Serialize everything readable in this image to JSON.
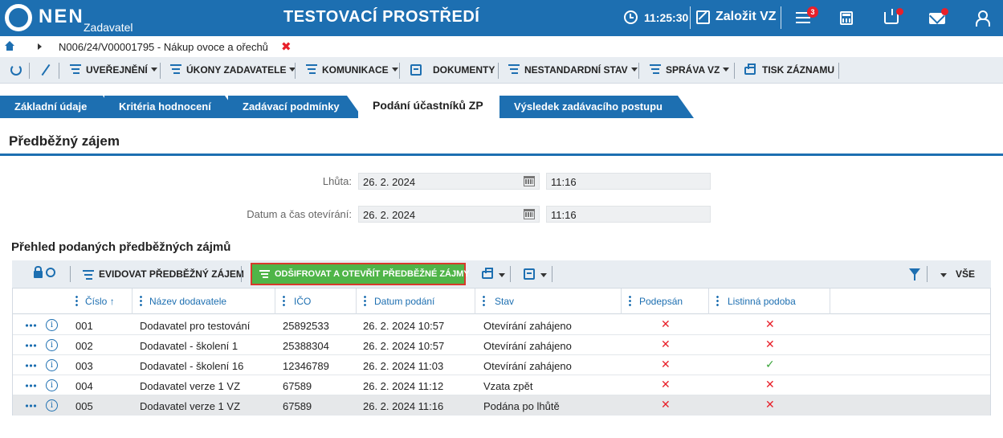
{
  "header": {
    "logo_text": "NEN",
    "logo_sub": "Zadavatel",
    "environment_title": "TESTOVACÍ PROSTŘEDÍ",
    "clock_time": "11:25:30",
    "new_vz_label": "Založit VZ",
    "notifications_badge": "3",
    "accent_color": "#1d6fb1"
  },
  "breadcrumb": {
    "text": "N006/24/V00001795 - Nákup ovoce a ořechů",
    "close_symbol": "✖"
  },
  "toolbar": {
    "uverejneni": "UVEŘEJNĚNÍ",
    "ukony": "ÚKONY ZADAVATELE",
    "komunikace": "KOMUNIKACE",
    "dokumenty": "DOKUMENTY",
    "nestandardni": "NESTANDARDNÍ STAV",
    "sprava": "SPRÁVA VZ",
    "tisk": "TISK ZÁZNAMU"
  },
  "tabs": [
    {
      "label": "Základní údaje"
    },
    {
      "label": "Kritéria hodnocení"
    },
    {
      "label": "Zadávací podmínky"
    },
    {
      "label": "Podání účastníků ZP"
    },
    {
      "label": "Výsledek zadávacího postupu"
    }
  ],
  "section": {
    "title": "Předběžný zájem"
  },
  "form": {
    "lhuta_label": "Lhůta:",
    "lhuta_date": "26. 2. 2024",
    "lhuta_time": "11:16",
    "otevreni_label": "Datum a čas otevírání:",
    "otevreni_date": "26. 2. 2024",
    "otevreni_time": "11:16"
  },
  "list": {
    "title": "Přehled podaných předběžných zájmů",
    "evidovat_label": "EVIDOVAT PŘEDBĚŽNÝ ZÁJEM",
    "odsifrovat_label": "ODŠIFROVAT A OTEVŘÍT PŘEDBĚŽNÉ ZÁJMY",
    "vse_label": "VŠE",
    "columns": {
      "cislo": "Číslo",
      "sort_symbol": "↑",
      "nazev": "Název dodavatele",
      "ico": "IČO",
      "datum": "Datum podání",
      "stav": "Stav",
      "podepsan": "Podepsán",
      "listinna": "Listinná podoba"
    },
    "rows": [
      {
        "cislo": "001",
        "nazev": "Dodavatel pro testování",
        "ico": "25892533",
        "datum": "26. 2. 2024 10:57",
        "stav": "Otevírání zahájeno",
        "podepsan": "✕",
        "listinna": "✕"
      },
      {
        "cislo": "002",
        "nazev": "Dodavatel - školení 1",
        "ico": "25388304",
        "datum": "26. 2. 2024 10:57",
        "stav": "Otevírání zahájeno",
        "podepsan": "✕",
        "listinna": "✕"
      },
      {
        "cislo": "003",
        "nazev": "Dodavatel - školení 16",
        "ico": "12346789",
        "datum": "26. 2. 2024 11:03",
        "stav": "Otevírání zahájeno",
        "podepsan": "✕",
        "listinna": "✓"
      },
      {
        "cislo": "004",
        "nazev": "Dodavatel verze 1 VZ",
        "ico": "67589",
        "datum": "26. 2. 2024 11:12",
        "stav": "Vzata zpět",
        "podepsan": "✕",
        "listinna": "✕"
      },
      {
        "cislo": "005",
        "nazev": "Dodavatel verze 1 VZ",
        "ico": "67589",
        "datum": "26. 2. 2024 11:16",
        "stav": "Podána po lhůtě",
        "podepsan": "✕",
        "listinna": "✕"
      }
    ]
  }
}
